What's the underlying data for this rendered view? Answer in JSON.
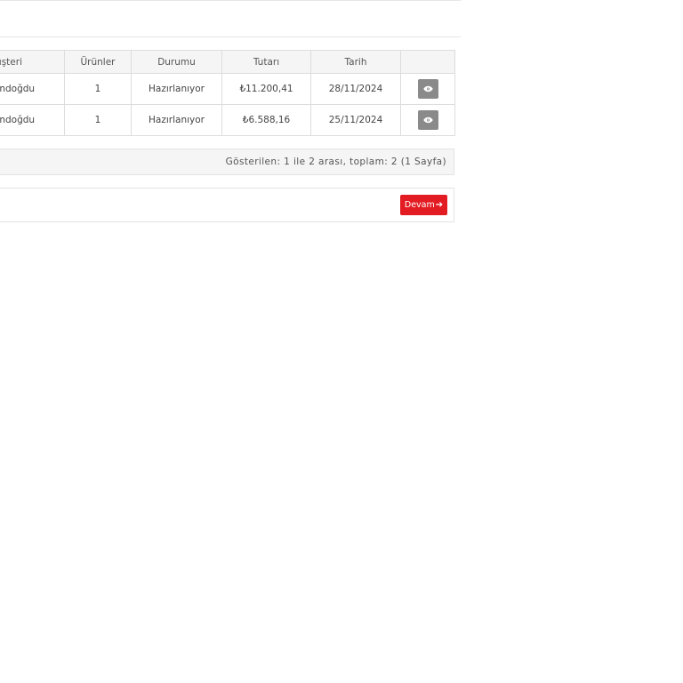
{
  "orders_table": {
    "columns": [
      "Müşteri",
      "Ürünler",
      "Durumu",
      "Tutarı",
      "Tarih",
      ""
    ],
    "rows": [
      {
        "customer": "gündoğdu",
        "products": "1",
        "status": "Hazırlanıyor",
        "amount": "₺11.200,41",
        "date": "28/11/2024"
      },
      {
        "customer": "gündoğdu",
        "products": "1",
        "status": "Hazırlanıyor",
        "amount": "₺6.588,16",
        "date": "25/11/2024"
      }
    ],
    "view_icon": "eye-icon"
  },
  "pagination": {
    "text": "Gösterilen: 1 ile 2 arası, toplam: 2 (1 Sayfa)"
  },
  "continue": {
    "label": "Devam",
    "icon": "arrow-right-icon",
    "arrow_glyph": "➔"
  },
  "colors": {
    "accent": "#e31b23",
    "view_button": "#8a8a8a",
    "header_bg": "#f5f5f5",
    "border": "#dddddd"
  }
}
